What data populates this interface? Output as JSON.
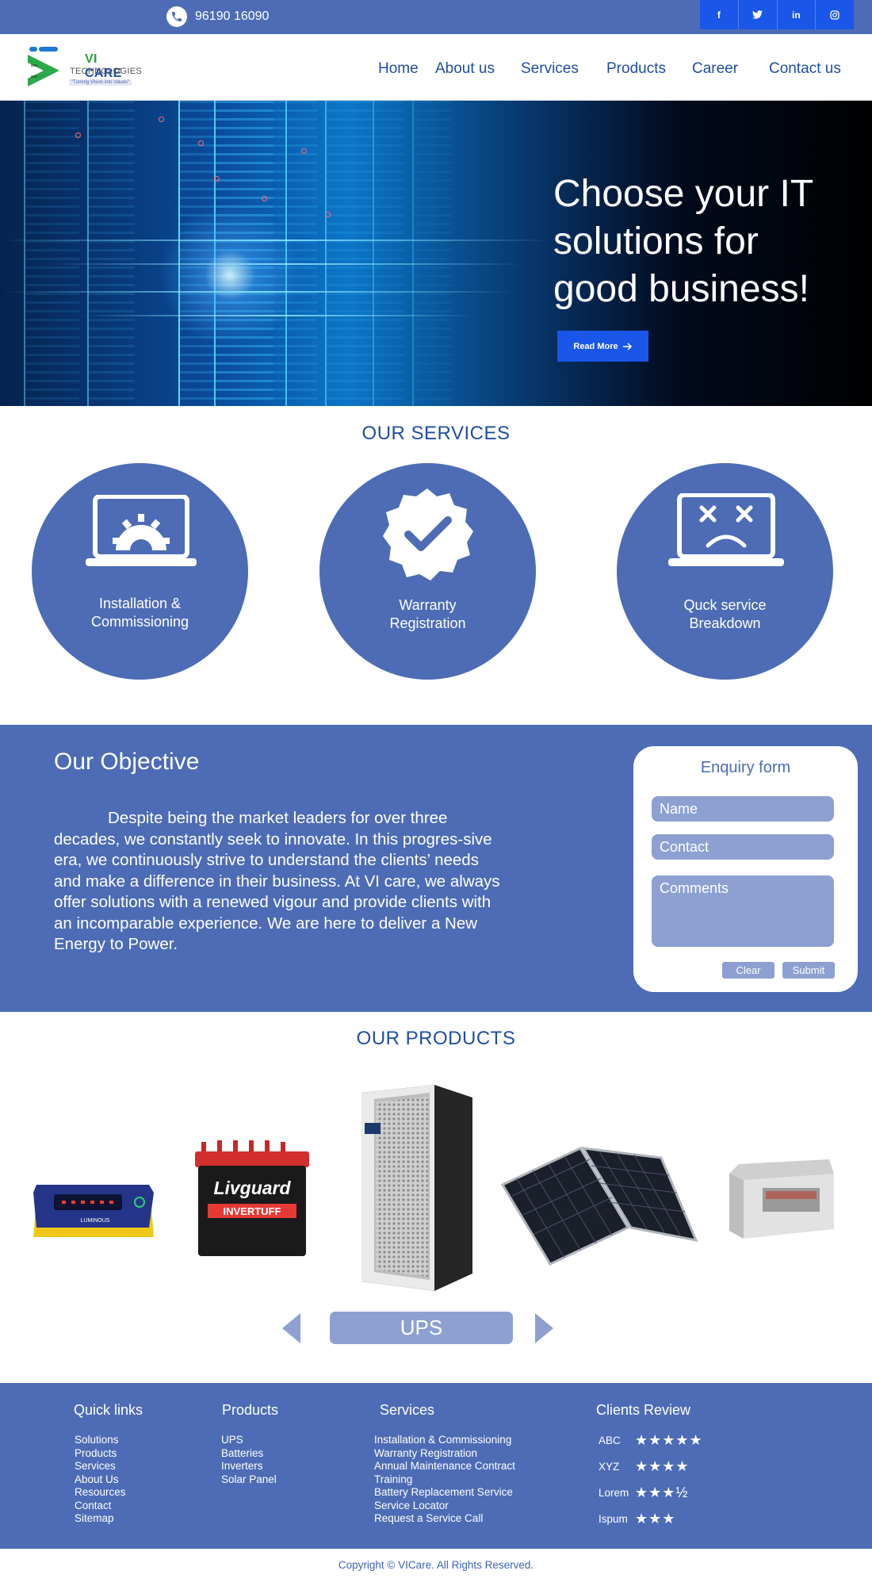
{
  "topbar": {
    "phone": "96190 16090"
  },
  "social": [
    "f",
    "t",
    "in",
    "ig"
  ],
  "logo": {
    "brand_vi": "VI",
    "brand_care": "CARE",
    "sub": "TECHNOLOGIES",
    "tagline": "\"Turning Vision into Values\""
  },
  "nav": {
    "home": "Home",
    "about": "About us",
    "services": "Services",
    "products": "Products",
    "career": "Career",
    "contact": "Contact us"
  },
  "hero": {
    "line1": "Choose your IT",
    "line2": "solutions for",
    "line3": "good business!",
    "cta": "Read More"
  },
  "services": {
    "title": "OUR  SERVICES",
    "items": [
      {
        "line1": "Installation &",
        "line2": "Commissioning",
        "icon": "laptop-gear-icon"
      },
      {
        "line1": "Warranty",
        "line2": "Registration",
        "icon": "check-badge-icon"
      },
      {
        "line1": "Quck service",
        "line2": "Breakdown",
        "icon": "broken-laptop-icon"
      }
    ]
  },
  "objective": {
    "title": "Our Objective",
    "text": "Despite being the market leaders for over three decades, we constantly seek to innovate. In this progres-sive era, we continuously strive to understand the clients’ needs and make a difference in their business. At VI care, we always offer solutions with a renewed vigour and provide clients with an incomparable experience. We are here to deliver a New Energy to Power."
  },
  "enquiry": {
    "title": "Enquiry form",
    "name_placeholder": "Name",
    "contact_placeholder": "Contact",
    "comments_placeholder": "Comments",
    "clear": "Clear",
    "submit": "Submit"
  },
  "products": {
    "title": "OUR  PRODUCTS",
    "items": [
      "inverter",
      "battery",
      "ups-cabinet",
      "solar-panel",
      "sealed-battery"
    ],
    "battery_brand": "Livguard",
    "battery_model": "INVERTUFF",
    "inverter_brand": "LUMINOUS",
    "selected": "UPS"
  },
  "footer": {
    "quick_title": "Quick links",
    "quick": [
      "Solutions",
      "Products",
      "Services",
      "About Us",
      "Resources",
      "Contact",
      "Sitemap"
    ],
    "products_title": "Products",
    "products": [
      "UPS",
      "Batteries",
      "Inverters",
      "Solar Panel"
    ],
    "services_title": "Services",
    "services": [
      "Installation & Commissioning",
      "Warranty Registration",
      "Annual Maintenance Contract",
      "Training",
      "Battery Replacement Service",
      "Service Locator",
      "Request a Service Call"
    ],
    "reviews_title": "Clients Review",
    "reviews": [
      {
        "name": "ABC",
        "stars": "★★★★★",
        "rating": 5
      },
      {
        "name": "XYZ",
        "stars": "★★★★",
        "rating": 4
      },
      {
        "name": "Lorem",
        "stars": "★★★½",
        "rating": 3.5
      },
      {
        "name": "Ispum",
        "stars": "★★★",
        "rating": 3
      }
    ]
  },
  "copyright": "Copyright © VICare. All Rights Reserved.",
  "colors": {
    "primary": "#4d6cb5",
    "accent": "#1a56e8",
    "link": "#1f4fa0",
    "field": "#8da0d1"
  }
}
